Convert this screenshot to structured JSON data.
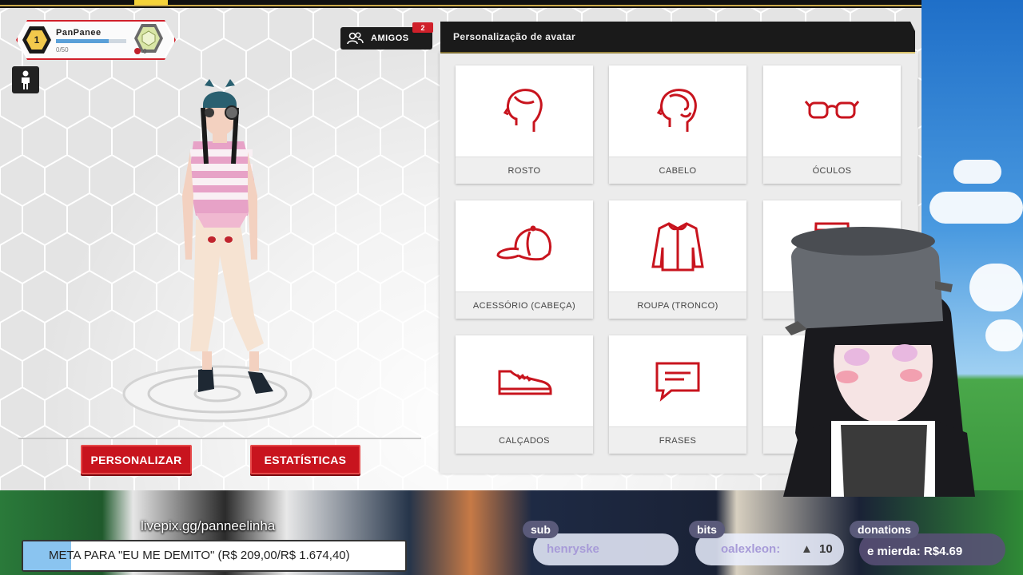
{
  "profile": {
    "level": "1",
    "name": "PanPanee",
    "xp_text": "0/50",
    "xp_progress": 0.75,
    "rank_points": "0"
  },
  "friends": {
    "label": "AMIGOS",
    "badge": "2"
  },
  "panel": {
    "title": "Personalização de avatar",
    "cards": [
      {
        "label": "ROSTO",
        "icon": "face-icon"
      },
      {
        "label": "CABELO",
        "icon": "hair-icon"
      },
      {
        "label": "ÓCULOS",
        "icon": "glasses-icon"
      },
      {
        "label": "ACESSÓRIO (CABEÇA)",
        "icon": "cap-icon"
      },
      {
        "label": "ROUPA (TRONCO)",
        "icon": "jacket-icon"
      },
      {
        "label": "R",
        "icon": "pants-icon"
      },
      {
        "label": "CALÇADOS",
        "icon": "shoe-icon"
      },
      {
        "label": "FRASES",
        "icon": "speech-bubble-icon"
      },
      {
        "label": "PO",
        "icon": "pose-icon"
      }
    ]
  },
  "buttons": {
    "personalizar": "PERSONALIZAR",
    "estatisticas": "ESTATÍSTICAS"
  },
  "stream": {
    "livepix": "livepix.gg/panneelinha",
    "meta": "META PARA \"EU ME DEMITO\" (R$ 209,00/R$ 1.674,40)",
    "meta_progress": 0.125,
    "sub": {
      "tag": "sub",
      "value": "henryske"
    },
    "bits": {
      "tag": "bits",
      "value": "oalexleon:",
      "amount": "10"
    },
    "donations": {
      "tag": "donations",
      "value": "e mierda: R$4.69"
    }
  },
  "colors": {
    "accent_red": "#c8141e",
    "panel_header": "#1a1a1a"
  }
}
